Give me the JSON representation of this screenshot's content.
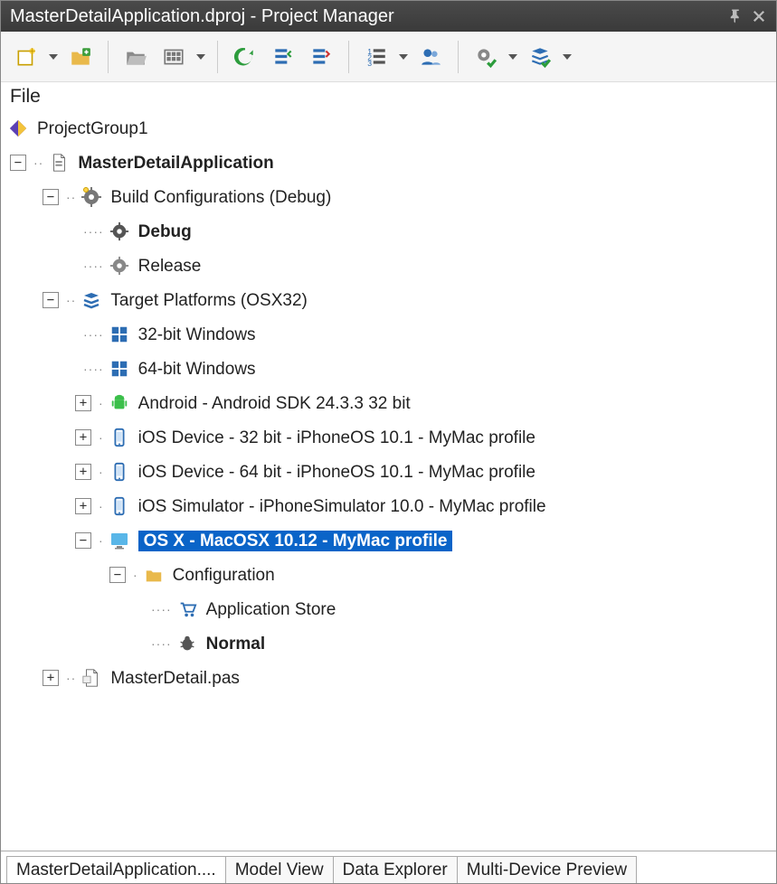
{
  "window": {
    "title": "MasterDetailApplication.dproj - Project Manager"
  },
  "menu": {
    "file": "File"
  },
  "tree": {
    "projectGroup": "ProjectGroup1",
    "project": "MasterDetailApplication",
    "buildConfigs": {
      "label": "Build Configurations (Debug)",
      "debug": "Debug",
      "release": "Release"
    },
    "targetPlatforms": {
      "label": "Target Platforms (OSX32)",
      "win32": "32-bit Windows",
      "win64": "64-bit Windows",
      "android": "Android - Android SDK 24.3.3 32 bit",
      "ios32": "iOS Device - 32 bit - iPhoneOS 10.1 - MyMac profile",
      "ios64": "iOS Device - 64 bit - iPhoneOS 10.1 - MyMac profile",
      "iosSim": "iOS Simulator - iPhoneSimulator 10.0 - MyMac profile",
      "osx": "OS X - MacOSX 10.12 - MyMac profile",
      "configuration": {
        "label": "Configuration",
        "appStore": "Application Store",
        "normal": "Normal"
      }
    },
    "sourceFile": "MasterDetail.pas"
  },
  "tabs": {
    "t0": "MasterDetailApplication....",
    "t1": "Model View",
    "t2": "Data Explorer",
    "t3": "Multi-Device Preview"
  }
}
